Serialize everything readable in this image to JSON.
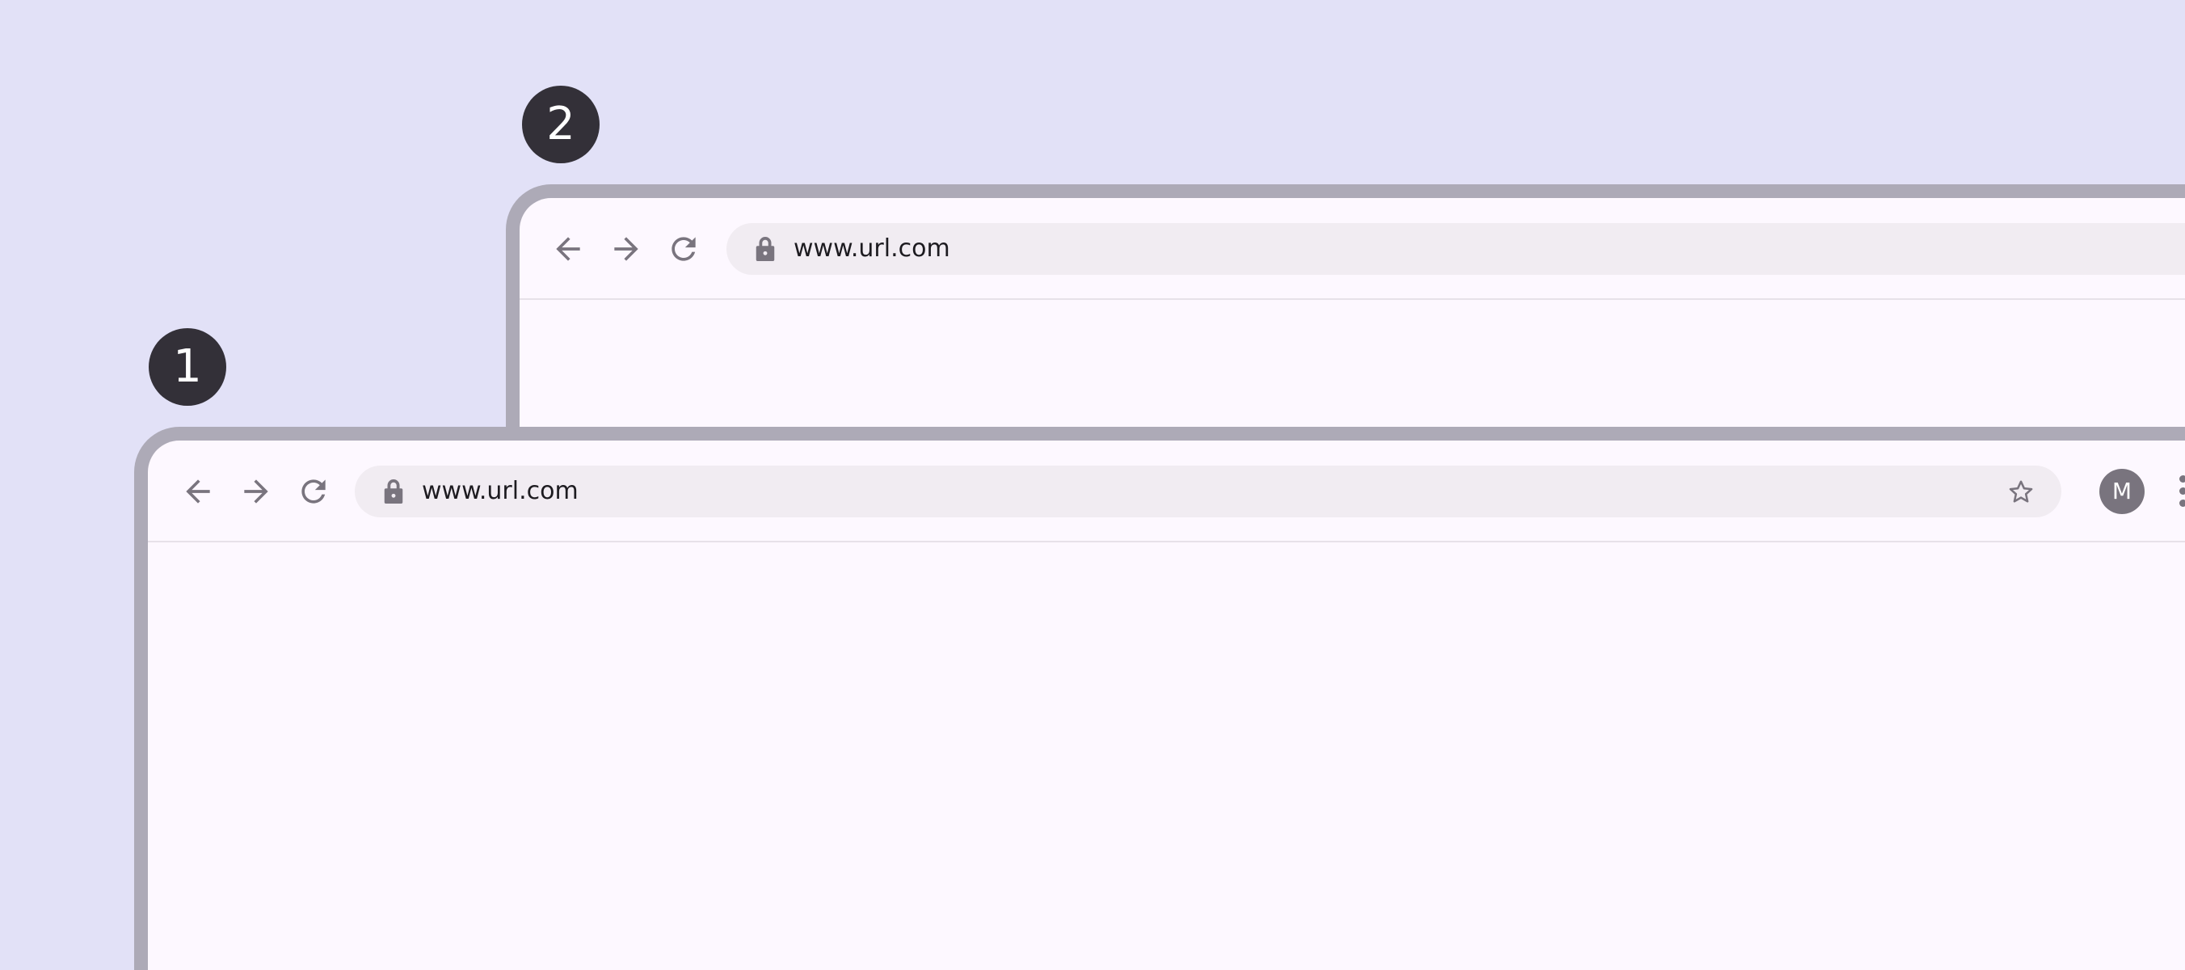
{
  "background": "#e2e1f7",
  "markers": [
    {
      "label": "1"
    },
    {
      "label": "2"
    }
  ],
  "windows": {
    "back": {
      "url": "www.url.com",
      "icons": [
        "arrow-back-icon",
        "arrow-forward-icon",
        "refresh-icon",
        "lock-icon"
      ]
    },
    "front": {
      "url": "www.url.com",
      "avatar_letter": "M",
      "icons": [
        "arrow-back-icon",
        "arrow-forward-icon",
        "refresh-icon",
        "lock-icon",
        "star-icon",
        "more-vert-icon"
      ]
    }
  },
  "colors": {
    "frame": "#adaab7",
    "surface": "#fdf8ff",
    "omnibox": "#f1ecf2",
    "icon": "#79747e",
    "marker": "#333038",
    "avatar": "#79747e"
  }
}
